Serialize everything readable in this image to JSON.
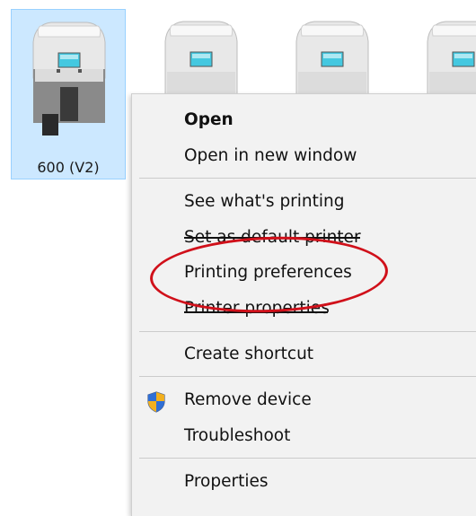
{
  "printer_tile": {
    "label": "600 (V2)"
  },
  "context_menu": {
    "items": [
      {
        "label": "Open"
      },
      {
        "label": "Open in new window"
      },
      {
        "label": "See what's printing"
      },
      {
        "label": "Set as default printer"
      },
      {
        "label": "Printing preferences"
      },
      {
        "label": "Printer properties"
      },
      {
        "label": "Create shortcut"
      },
      {
        "label": "Remove device",
        "icon": "uac-shield-icon"
      },
      {
        "label": "Troubleshoot"
      },
      {
        "label": "Properties"
      }
    ]
  },
  "annotation": {
    "highlighted_item": "Printing preferences",
    "color": "#d0101a"
  },
  "colors": {
    "selection_bg": "#cce8ff",
    "selection_border": "#99d1ff",
    "menu_bg": "#f2f2f2"
  }
}
